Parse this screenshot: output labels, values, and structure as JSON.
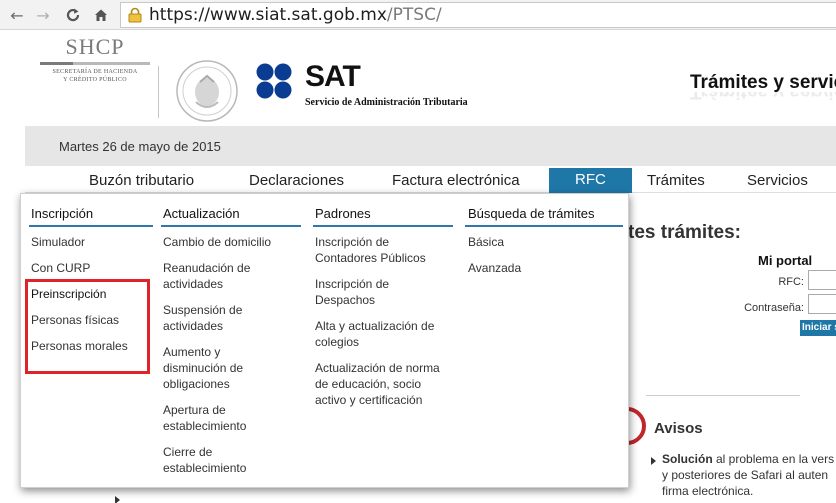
{
  "browser": {
    "url_host": "https://www.siat.sat.gob.mx",
    "url_path": "/PTSC/"
  },
  "header": {
    "shcp_title": "SHCP",
    "shcp_sub_1": "SECRETARÍA DE HACIENDA",
    "shcp_sub_2": "Y CRÉDITO PÚBLICO",
    "sat_word": "SAT",
    "sat_sub": "Servicio de Administración Tributaria",
    "page_title": "Trámites y servici"
  },
  "date": "Martes 26 de mayo de 2015",
  "nav": {
    "items": [
      {
        "label": "Buzón tributario"
      },
      {
        "label": "Declaraciones"
      },
      {
        "label": "Factura electrónica"
      },
      {
        "label": "RFC"
      },
      {
        "label": "Trámites"
      },
      {
        "label": "Servicios"
      }
    ]
  },
  "dropdown": {
    "columns": [
      {
        "heading": "Inscripción",
        "links": [
          "Simulador",
          "Con CURP",
          "Preinscripción",
          "Personas físicas",
          "Personas morales"
        ]
      },
      {
        "heading": "Actualización",
        "links": [
          "Cambio de domicilio",
          "Reanudación de actividades",
          "Suspensión de actividades",
          "Aumento y disminución de obligaciones",
          "Apertura de establecimiento",
          "Cierre de establecimiento"
        ]
      },
      {
        "heading": "Padrones",
        "links": [
          "Inscripción de Contadores Públicos",
          "Inscripción de Despachos",
          "Alta y actualización de colegios",
          "Actualización de norma de educación, socio activo y certificación"
        ]
      },
      {
        "heading": "Búsqueda de trámites",
        "links": [
          "Básica",
          "Avanzada"
        ]
      }
    ],
    "highlight_color": "#e0232b"
  },
  "background": {
    "section_title": "tes trámites:",
    "portal_title": "Mi portal",
    "rfc_label": "RFC:",
    "password_label": "Contraseña:",
    "login_button": "Iniciar s",
    "avisos_title": "Avisos",
    "aviso_bold": "Solución",
    "aviso_line1": " al problema en la vers",
    "aviso_line2": "y posteriores de Safari al auten",
    "aviso_line3": "firma electrónica."
  },
  "colors": {
    "accent": "#1f77a8",
    "rule": "#2e78ad",
    "avisos_ring": "#c0272d"
  }
}
